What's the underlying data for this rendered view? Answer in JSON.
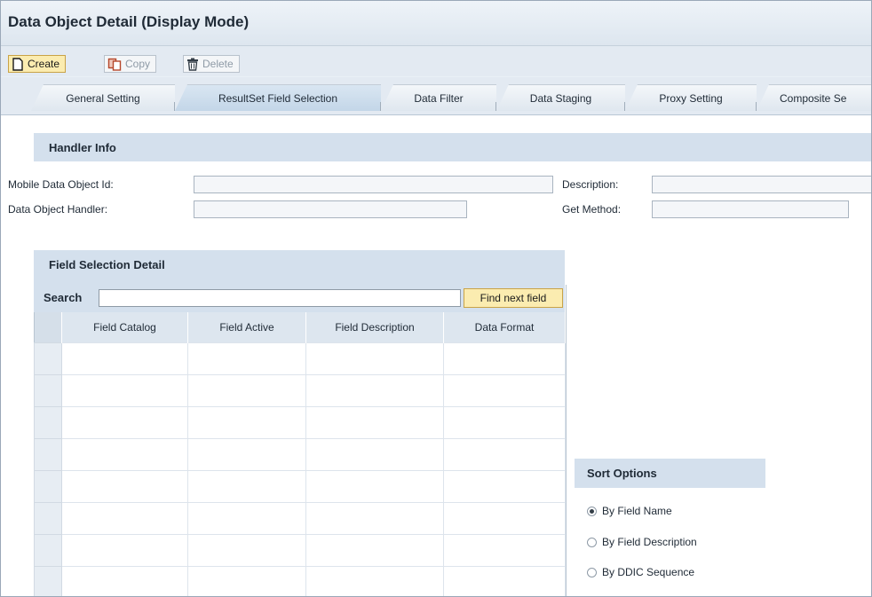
{
  "window": {
    "title": "Data Object Detail (Display Mode)"
  },
  "toolbar": {
    "create_label": "Create",
    "copy_label": "Copy",
    "delete_label": "Delete"
  },
  "tabs": [
    {
      "label": "General Setting",
      "active": false
    },
    {
      "label": "ResultSet Field Selection",
      "active": true
    },
    {
      "label": "Data Filter",
      "active": false
    },
    {
      "label": "Data Staging",
      "active": false
    },
    {
      "label": "Proxy Setting",
      "active": false
    },
    {
      "label": "Composite Se",
      "active": false
    }
  ],
  "handler_info": {
    "title": "Handler Info",
    "mobile_id_label": "Mobile Data Object Id:",
    "mobile_id_value": "",
    "description_label": "Description:",
    "description_value": "",
    "handler_label": "Data Object Handler:",
    "handler_value": "",
    "get_method_label": "Get Method:",
    "get_method_value": ""
  },
  "field_selection": {
    "title": "Field Selection Detail",
    "search_label": "Search",
    "search_value": "",
    "find_next_label": "Find next field",
    "columns": [
      "Field Catalog",
      "Field Active",
      "Field Description",
      "Data Format"
    ]
  },
  "sort_options": {
    "title": "Sort Options",
    "options": [
      {
        "label": "By Field Name",
        "checked": true
      },
      {
        "label": "By Field Description",
        "checked": false
      },
      {
        "label": "By DDIC Sequence",
        "checked": false
      }
    ]
  },
  "colors": {
    "section_header": "#d4e0ed",
    "active_button": "#fbecb0",
    "background": "#eaf0f6"
  }
}
